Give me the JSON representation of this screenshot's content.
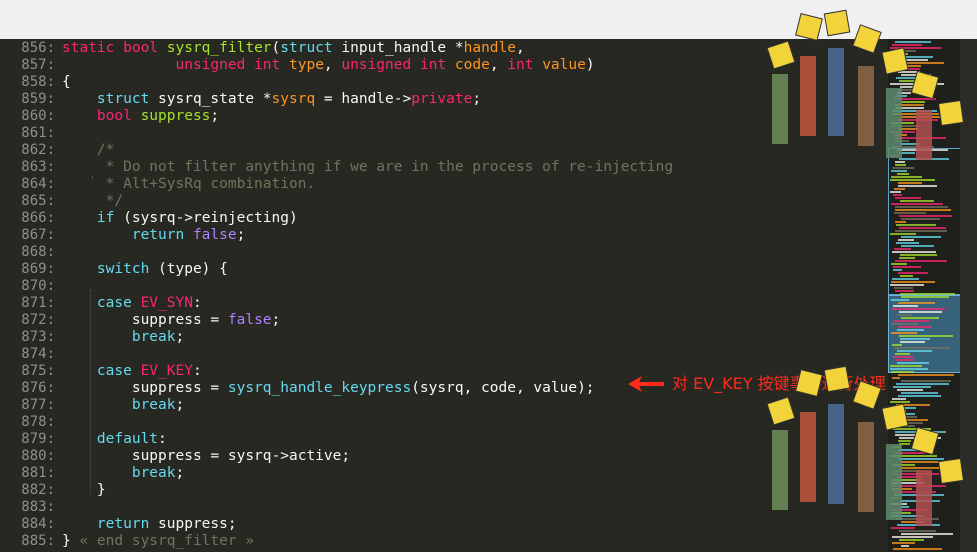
{
  "editor": {
    "lines": [
      {
        "num": "856:",
        "tokens": [
          [
            "static ",
            "key"
          ],
          [
            "bool ",
            "key"
          ],
          [
            "sysrq_filter",
            "fn"
          ],
          [
            "(",
            "plain"
          ],
          [
            "struct ",
            "kw"
          ],
          [
            "input_handle ",
            "plain"
          ],
          [
            "*",
            "plain"
          ],
          [
            "handle",
            "param"
          ],
          [
            ",",
            "plain"
          ]
        ]
      },
      {
        "num": "857:",
        "tokens": [
          [
            "             ",
            "plain"
          ],
          [
            "unsigned ",
            "key"
          ],
          [
            "int ",
            "key"
          ],
          [
            "type",
            "param"
          ],
          [
            ", ",
            "plain"
          ],
          [
            "unsigned ",
            "key"
          ],
          [
            "int ",
            "key"
          ],
          [
            "code",
            "param"
          ],
          [
            ", ",
            "plain"
          ],
          [
            "int ",
            "key"
          ],
          [
            "value",
            "param"
          ],
          [
            ")",
            "plain"
          ]
        ]
      },
      {
        "num": "858:",
        "tokens": [
          [
            "{",
            "plain"
          ]
        ]
      },
      {
        "num": "859:",
        "tokens": [
          [
            "    ",
            "plain"
          ],
          [
            "struct ",
            "kw"
          ],
          [
            "sysrq_state ",
            "plain"
          ],
          [
            "*",
            "plain"
          ],
          [
            "sysrq",
            "param"
          ],
          [
            " = handle->",
            "plain"
          ],
          [
            "private",
            "key"
          ],
          [
            ";",
            "plain"
          ]
        ]
      },
      {
        "num": "860:",
        "tokens": [
          [
            "    ",
            "plain"
          ],
          [
            "bool ",
            "key"
          ],
          [
            "suppress",
            "fn"
          ],
          [
            ";",
            "plain"
          ]
        ]
      },
      {
        "num": "861:",
        "tokens": []
      },
      {
        "num": "862:",
        "tokens": [
          [
            "    ",
            "plain"
          ],
          [
            "/*",
            "cmt"
          ]
        ]
      },
      {
        "num": "863:",
        "tokens": [
          [
            "    ",
            "plain"
          ],
          [
            " * Do not filter anything if we are in the process of re-injecting",
            "cmt"
          ]
        ]
      },
      {
        "num": "864:",
        "tokens": [
          [
            "    ",
            "plain"
          ],
          [
            " * Alt+SysRq combination.",
            "cmt"
          ]
        ]
      },
      {
        "num": "865:",
        "tokens": [
          [
            "    ",
            "plain"
          ],
          [
            " */",
            "cmt"
          ]
        ]
      },
      {
        "num": "866:",
        "tokens": [
          [
            "    ",
            "plain"
          ],
          [
            "if ",
            "kw"
          ],
          [
            "(sysrq->reinjecting)",
            "plain"
          ]
        ]
      },
      {
        "num": "867:",
        "tokens": [
          [
            "        ",
            "plain"
          ],
          [
            "return ",
            "kw"
          ],
          [
            "false",
            "val"
          ],
          [
            ";",
            "plain"
          ]
        ]
      },
      {
        "num": "868:",
        "tokens": []
      },
      {
        "num": "869:",
        "tokens": [
          [
            "    ",
            "plain"
          ],
          [
            "switch ",
            "kw"
          ],
          [
            "(type) {",
            "plain"
          ]
        ]
      },
      {
        "num": "870:",
        "tokens": []
      },
      {
        "num": "871:",
        "tokens": [
          [
            "    ",
            "plain"
          ],
          [
            "case ",
            "kw"
          ],
          [
            "EV_SYN",
            "key"
          ],
          [
            ":",
            "plain"
          ]
        ]
      },
      {
        "num": "872:",
        "tokens": [
          [
            "        ",
            "plain"
          ],
          [
            "suppress = ",
            "plain"
          ],
          [
            "false",
            "val"
          ],
          [
            ";",
            "plain"
          ]
        ]
      },
      {
        "num": "873:",
        "tokens": [
          [
            "        ",
            "plain"
          ],
          [
            "break",
            "kw"
          ],
          [
            ";",
            "plain"
          ]
        ]
      },
      {
        "num": "874:",
        "tokens": []
      },
      {
        "num": "875:",
        "tokens": [
          [
            "    ",
            "plain"
          ],
          [
            "case ",
            "kw"
          ],
          [
            "EV_KEY",
            "key"
          ],
          [
            ":",
            "plain"
          ]
        ]
      },
      {
        "num": "876:",
        "tokens": [
          [
            "        ",
            "plain"
          ],
          [
            "suppress = ",
            "plain"
          ],
          [
            "sysrq_handle_keypress",
            "kw"
          ],
          [
            "(sysrq, code, value);",
            "plain"
          ]
        ]
      },
      {
        "num": "877:",
        "tokens": [
          [
            "        ",
            "plain"
          ],
          [
            "break",
            "kw"
          ],
          [
            ";",
            "plain"
          ]
        ]
      },
      {
        "num": "878:",
        "tokens": []
      },
      {
        "num": "879:",
        "tokens": [
          [
            "    ",
            "plain"
          ],
          [
            "default",
            "kw"
          ],
          [
            ":",
            "plain"
          ]
        ]
      },
      {
        "num": "880:",
        "tokens": [
          [
            "        ",
            "plain"
          ],
          [
            "suppress = sysrq->active;",
            "plain"
          ]
        ]
      },
      {
        "num": "881:",
        "tokens": [
          [
            "        ",
            "plain"
          ],
          [
            "break",
            "kw"
          ],
          [
            ";",
            "plain"
          ]
        ]
      },
      {
        "num": "882:",
        "tokens": [
          [
            "    ",
            "plain"
          ],
          [
            "}",
            "plain"
          ]
        ]
      },
      {
        "num": "883:",
        "tokens": []
      },
      {
        "num": "884:",
        "tokens": [
          [
            "    ",
            "plain"
          ],
          [
            "return ",
            "kw"
          ],
          [
            "suppress;",
            "plain"
          ]
        ]
      },
      {
        "num": "885:",
        "tokens": [
          [
            "} ",
            "plain"
          ],
          [
            "« end sysrq_filter »",
            "cmt"
          ]
        ]
      }
    ]
  },
  "annotation": {
    "text": "对 EV_KEY 按键事件进行处理",
    "color": "#ff2b1c"
  },
  "colors": {
    "background": "#272822",
    "keyword": "#66d9ef",
    "storage": "#f92672",
    "function": "#a6e22e",
    "parameter": "#fd971f",
    "constant": "#ae81ff",
    "comment": "#75715e"
  }
}
